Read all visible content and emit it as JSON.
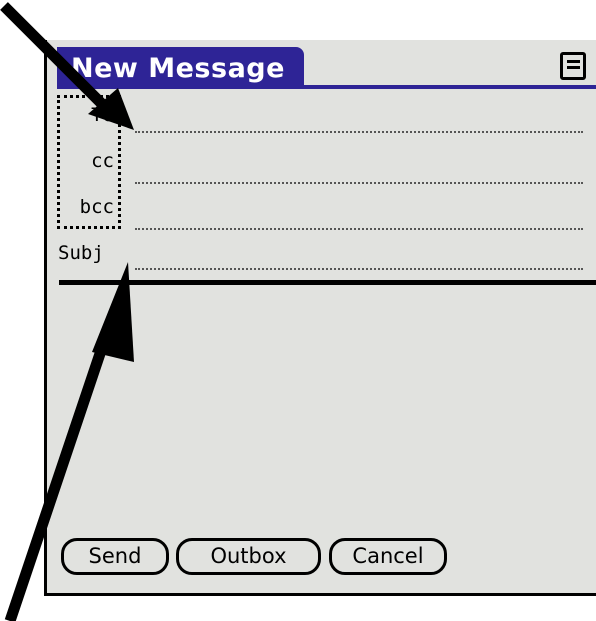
{
  "title": "New Message",
  "menu_icon": "menu-icon",
  "fields": {
    "to": {
      "label": "To",
      "value": ""
    },
    "cc": {
      "label": "cc",
      "value": ""
    },
    "bcc": {
      "label": "bcc",
      "value": ""
    },
    "subj": {
      "label": "Subj",
      "value": ""
    }
  },
  "body": "",
  "buttons": {
    "send": "Send",
    "outbox": "Outbox",
    "cancel": "Cancel"
  },
  "colors": {
    "title_bar": "#2e2496",
    "screen_bg": "#e1e2df",
    "title_text": "#ffffff"
  },
  "annotations": [
    "arrow-pointing-to-to-field",
    "arrow-pointing-to-subj-field"
  ]
}
